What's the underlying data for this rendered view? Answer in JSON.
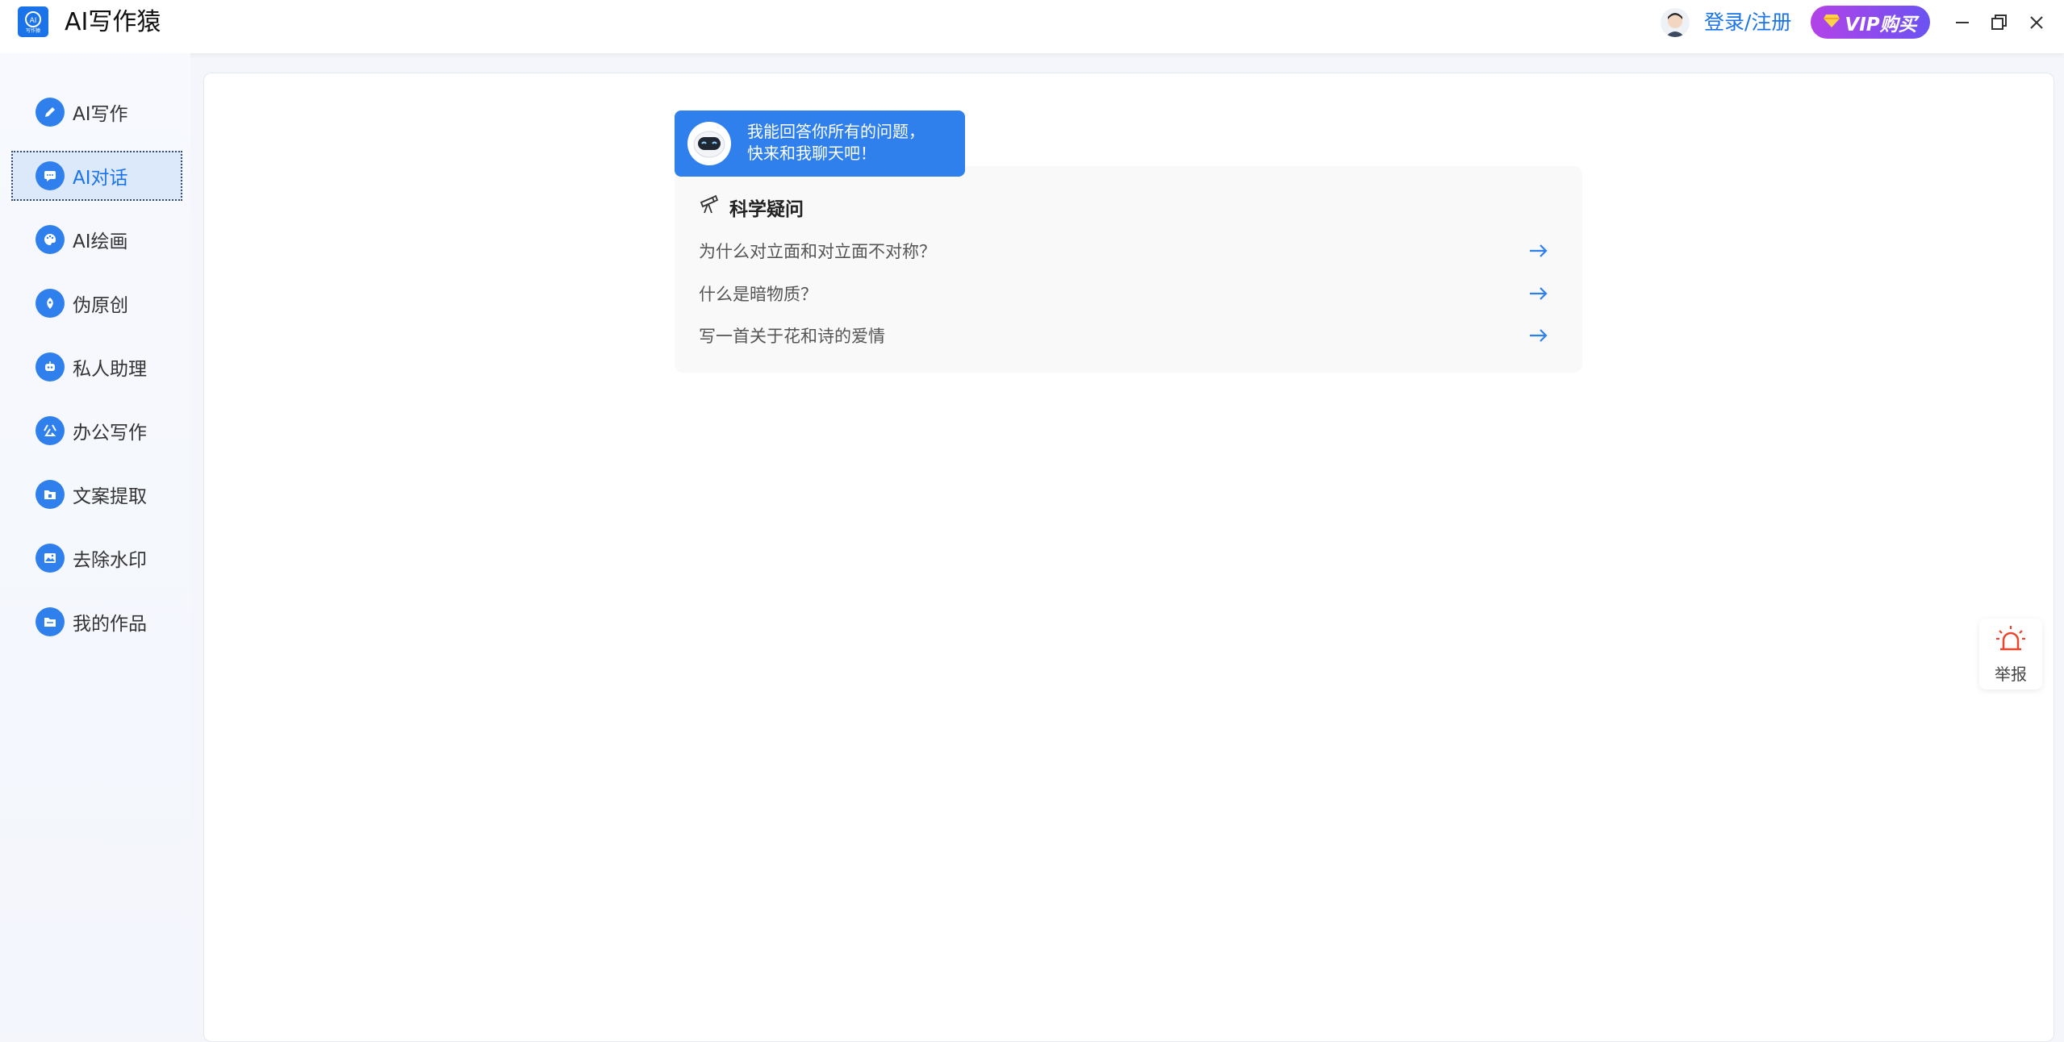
{
  "header": {
    "app_title": "AI写作猿",
    "logo_text": "写作猿",
    "login_label": "登录/注册",
    "vip_label": "VIP购买"
  },
  "sidebar": {
    "items": [
      {
        "label": "AI写作",
        "icon": "pencil-icon"
      },
      {
        "label": "AI对话",
        "icon": "chat-icon",
        "active": true
      },
      {
        "label": "AI绘画",
        "icon": "palette-icon"
      },
      {
        "label": "伪原创",
        "icon": "pen-nib-icon"
      },
      {
        "label": "私人助理",
        "icon": "robot-icon"
      },
      {
        "label": "办公写作",
        "icon": "gong-icon"
      },
      {
        "label": "文案提取",
        "icon": "folder-icon"
      },
      {
        "label": "去除水印",
        "icon": "image-icon"
      },
      {
        "label": "我的作品",
        "icon": "folder-icon"
      }
    ]
  },
  "chat": {
    "greeting_line1": "我能回答你所有的问题，",
    "greeting_line2": "快来和我聊天吧！",
    "section_title": "科学疑问",
    "questions": [
      "为什么对立面和对立面不对称？",
      "什么是暗物质？",
      "写一首关于花和诗的爱情"
    ]
  },
  "report": {
    "label": "举报"
  },
  "colors": {
    "accent": "#2f80ed",
    "vip_start": "#b342e8",
    "vip_end": "#6b52f2",
    "report": "#e8472e"
  }
}
